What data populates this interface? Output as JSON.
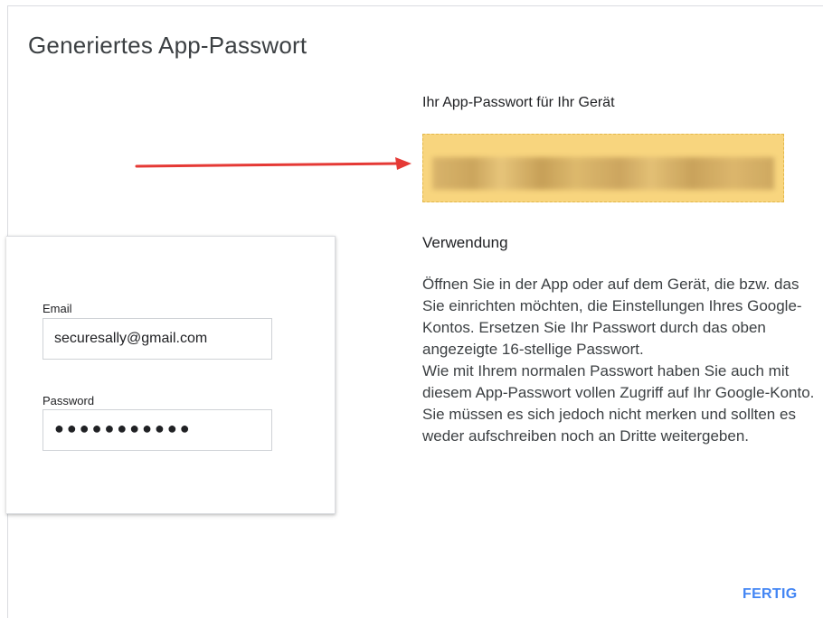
{
  "dialog": {
    "title": "Generiertes App-Passwort",
    "password_heading": "Ihr App-Passwort für Ihr Gerät",
    "usage_heading": "Verwendung",
    "usage_paragraph_1": "Öffnen Sie in der App oder auf dem Gerät, die bzw. das Sie einrichten möchten, die Einstellungen Ihres Google-Kontos. Ersetzen Sie Ihr Passwort durch das oben angezeigte 16-stellige Passwort.",
    "usage_paragraph_2": "Wie mit Ihrem normalen Passwort haben Sie auch mit diesem App-Passwort vollen Zugriff auf Ihr Google-Konto. Sie müssen es sich jedoch nicht merken und sollten es weder aufschreiben noch an Dritte weitergeben.",
    "done_label": "FERTIG"
  },
  "device": {
    "email_label": "Email",
    "email_value": "securesally@gmail.com",
    "password_label": "Password",
    "password_value": "●●●●●●●●●●●"
  },
  "colors": {
    "password_box": "#f8d57e",
    "arrow": "#e53935",
    "done": "#4285f4"
  },
  "icons": {
    "arrow": "arrow-right-icon"
  }
}
